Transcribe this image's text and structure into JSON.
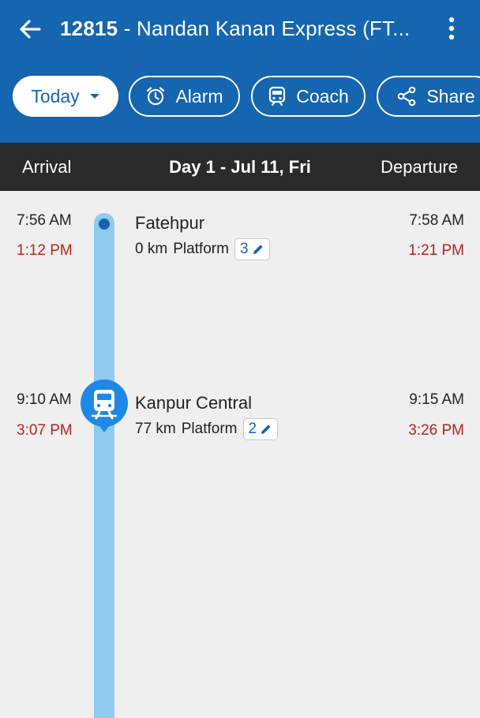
{
  "header": {
    "train_number": "12815",
    "title_rest": " - Nandan Kanan Express (FT...",
    "back_icon": "arrow-left-icon",
    "menu_icon": "more-vertical-icon"
  },
  "chips": {
    "today": "Today",
    "alarm": "Alarm",
    "coach": "Coach",
    "share": "Share"
  },
  "day_header": {
    "arrival": "Arrival",
    "day": "Day 1 - Jul 11, Fri",
    "departure": "Departure"
  },
  "stations": [
    {
      "name": "Fatehpur",
      "km": "0 km",
      "platform_label": "Platform",
      "platform": "3",
      "sched_arrival": "7:56 AM",
      "actual_arrival": "1:12 PM",
      "sched_departure": "7:58 AM",
      "actual_departure": "1:21 PM"
    },
    {
      "name": "Kanpur Central",
      "km": "77 km",
      "platform_label": "Platform",
      "platform": "2",
      "sched_arrival": "9:10 AM",
      "actual_arrival": "3:07 PM",
      "sched_departure": "9:15 AM",
      "actual_departure": "3:26 PM"
    }
  ],
  "colors": {
    "primary": "#1565b0",
    "late": "#b3261e",
    "timeline": "#90caf0",
    "marker": "#1e88e5",
    "day_header_bg": "#2a2a2a"
  }
}
